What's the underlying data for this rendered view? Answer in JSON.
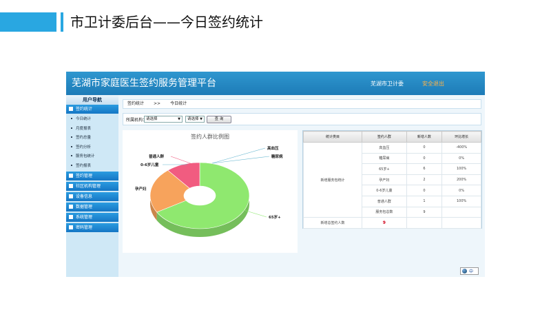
{
  "slide": {
    "title": "市卫计委后台——今日签约统计"
  },
  "app": {
    "title": "芜湖市家庭医生签约服务管理平台",
    "user": "芜湖市卫计委",
    "logout": "安全退出"
  },
  "sidebar": {
    "heading": "用户导航",
    "group1": "签约统计",
    "subitems": [
      "今日统计",
      "月度报表",
      "签约总量",
      "签约分析",
      "服务包统计",
      "签约报表"
    ],
    "sections": [
      "签约管理",
      "社区机构管理",
      "设备信息",
      "数据管理",
      "系统管理",
      "密码管理"
    ]
  },
  "breadcrumb": [
    "签约统计",
    ">>",
    "今日统计"
  ],
  "filter": {
    "label": "所属机构：",
    "select1": "请选择",
    "select2": "请选择",
    "query": "查 询"
  },
  "chart_data": {
    "type": "pie",
    "title": "签约人群比例图",
    "slices": [
      {
        "label": "高血压",
        "value": 0
      },
      {
        "label": "糖尿病",
        "value": 0
      },
      {
        "label": "65岁+",
        "value": 6
      },
      {
        "label": "孕产妇",
        "value": 2
      },
      {
        "label": "0-6岁儿童",
        "value": 0
      },
      {
        "label": "普通人群",
        "value": 1
      }
    ],
    "colors": {
      "65岁+": "#8fe86f",
      "孕产妇": "#f7a35c",
      "普通人群": "#f15c80"
    }
  },
  "table": {
    "headers": [
      "统计类目",
      "签约人群",
      "新增人数",
      "环比增长"
    ],
    "category": "新增服务包统计",
    "rows": [
      [
        "高血压",
        "0",
        "-400%"
      ],
      [
        "糖尿病",
        "0",
        "0%"
      ],
      [
        "65岁+",
        "6",
        "100%"
      ],
      [
        "孕产妇",
        "2",
        "200%"
      ],
      [
        "0-6岁儿童",
        "0",
        "0%"
      ],
      [
        "普通人群",
        "1",
        "100%"
      ],
      [
        "服务包总数",
        "9",
        ""
      ]
    ],
    "footer_label": "新增总签约人数",
    "footer_value": "9"
  },
  "lang": {
    "label": "中"
  }
}
